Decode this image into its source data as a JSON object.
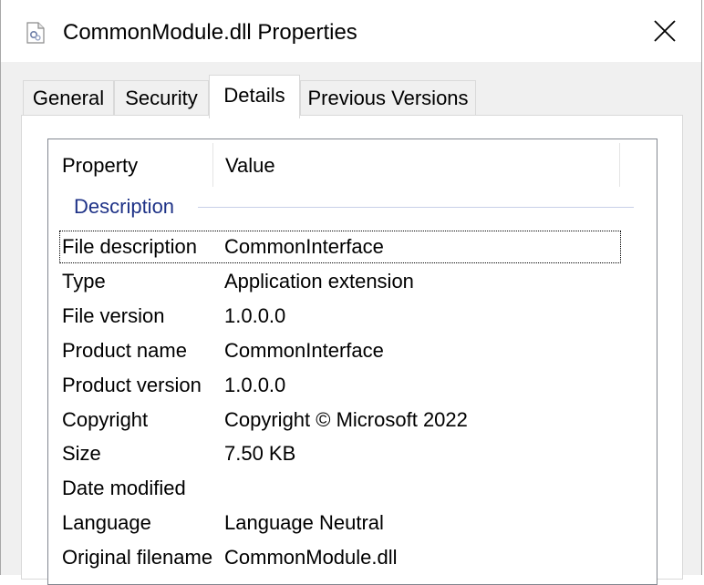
{
  "window": {
    "title": "CommonModule.dll Properties"
  },
  "tabs": [
    {
      "label": "General",
      "active": false
    },
    {
      "label": "Security",
      "active": false
    },
    {
      "label": "Details",
      "active": true
    },
    {
      "label": "Previous Versions",
      "active": false
    }
  ],
  "details": {
    "columns": {
      "property": "Property",
      "value": "Value"
    },
    "group": "Description",
    "rows": [
      {
        "property": "File description",
        "value": "CommonInterface"
      },
      {
        "property": "Type",
        "value": "Application extension"
      },
      {
        "property": "File version",
        "value": "1.0.0.0"
      },
      {
        "property": "Product name",
        "value": "CommonInterface"
      },
      {
        "property": "Product version",
        "value": "1.0.0.0"
      },
      {
        "property": "Copyright",
        "value": "Copyright © Microsoft 2022"
      },
      {
        "property": "Size",
        "value": "7.50 KB"
      },
      {
        "property": "Date modified",
        "value": ""
      },
      {
        "property": "Language",
        "value": "Language Neutral"
      },
      {
        "property": "Original filename",
        "value": "CommonModule.dll"
      }
    ]
  },
  "colors": {
    "group_header": "#1e3287",
    "list_border": "#828790",
    "window_bg": "#f0f0f0"
  },
  "icons": {
    "title": "dll-file-icon",
    "close": "close-icon"
  }
}
